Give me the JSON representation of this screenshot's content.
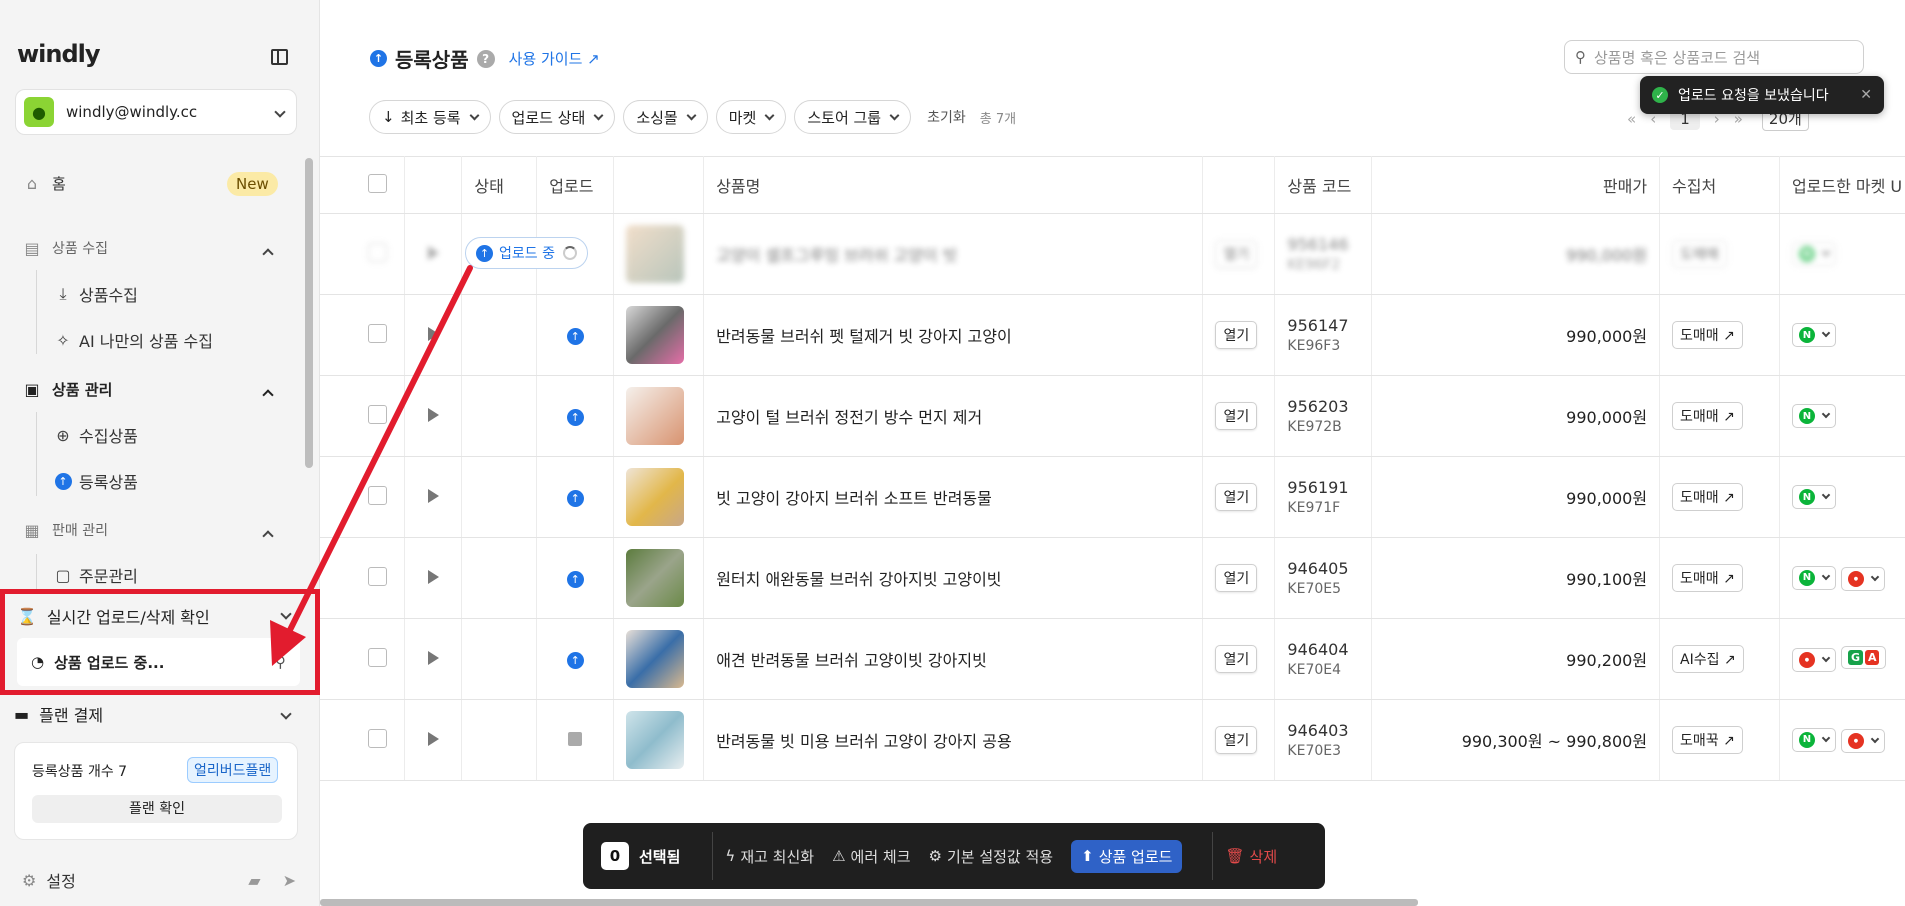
{
  "sidebar": {
    "logo": "windly",
    "account_email": "windly@windly.cc",
    "home": "홈",
    "new_badge": "New",
    "sec_collect": "상품 수집",
    "collect_items": [
      "상품수집",
      "AI 나만의 상품 수집"
    ],
    "sec_manage": "상품 관리",
    "manage_items": [
      "수집상품",
      "등록상품"
    ],
    "sec_sales": "판매 관리",
    "sales_items": [
      "주문관리"
    ],
    "realtime_title": "실시간 업로드/삭제 확인",
    "realtime_item": "상품 업로드 중...",
    "plan_title": "플랜 결제",
    "plan_count": "등록상품 개수 7",
    "plan_badge": "얼리버드플랜",
    "plan_button": "플랜 확인",
    "settings": "설정"
  },
  "header": {
    "title": "등록상품",
    "guide": "사용 가이드",
    "search_placeholder": "상품명 혹은 상품코드 검색"
  },
  "filters": {
    "sort": "최초 등록",
    "items": [
      "업로드 상태",
      "소싱몰",
      "마켓",
      "스토어 그룹"
    ],
    "reset": "초기화",
    "total": "총 7개"
  },
  "pager": {
    "first": "«",
    "prev": "‹",
    "page": "1",
    "next": "›",
    "last": "»",
    "size": "20개"
  },
  "toast": {
    "text": "업로드 요청을 보냈습니다",
    "close": "✕"
  },
  "columns": {
    "status": "상태",
    "upload": "업로드",
    "name": "상품명",
    "code": "상품 코드",
    "price": "판매가",
    "source": "수집처",
    "market": "업로드한 마켓 U"
  },
  "blurred_row": {
    "status_pill": "업로드 중",
    "name": "고양이 셀프그루밍 브러쉬 고양이 빗",
    "open": "열기",
    "code1": "956146",
    "code2": "KE96F2",
    "price": "990,000원",
    "source": "도매매"
  },
  "rows": [
    {
      "name": "반려동물 브러쉬 펫 털제거 빗 강아지 고양이",
      "open": "열기",
      "code1": "956147",
      "code2": "KE96F3",
      "price": "990,000원",
      "source": "도매매",
      "markets": [
        "N"
      ]
    },
    {
      "name": "고양이 털 브러쉬 정전기 방수 먼지 제거",
      "open": "열기",
      "code1": "956203",
      "code2": "KE972B",
      "price": "990,000원",
      "source": "도매매",
      "markets": [
        "N"
      ]
    },
    {
      "name": "빗 고양이 강아지 브러쉬 소프트 반려동물",
      "open": "열기",
      "code1": "956191",
      "code2": "KE971F",
      "price": "990,000원",
      "source": "도매매",
      "markets": [
        "N"
      ]
    },
    {
      "name": "원터치 애완동물 브러쉬 강아지빗 고양이빗",
      "open": "열기",
      "code1": "946405",
      "code2": "KE70E5",
      "price": "990,100원",
      "source": "도매매",
      "markets": [
        "N",
        "C"
      ]
    },
    {
      "name": "애견 반려동물 브러쉬 고양이빗 강아지빗",
      "open": "열기",
      "code1": "946404",
      "code2": "KE70E4",
      "price": "990,200원",
      "source": "AI수집",
      "markets": [
        "C",
        "GA"
      ]
    },
    {
      "name": "반려동물 빗 미용 브러쉬 고양이 강아지 공용",
      "open": "열기",
      "code1": "946403",
      "code2": "KE70E3",
      "price": "990,300원 ~ 990,800원",
      "source": "도매꾹",
      "markets": [
        "N",
        "C"
      ]
    }
  ],
  "actionbar": {
    "count": "0",
    "selected": "선택됨",
    "refresh": "재고 최신화",
    "error": "에러 체크",
    "apply": "기본 설정값 적용",
    "upload": "상품 업로드",
    "delete": "삭제"
  },
  "colors": {
    "accent": "#1f74e6",
    "annotation": "#e21c2e"
  }
}
